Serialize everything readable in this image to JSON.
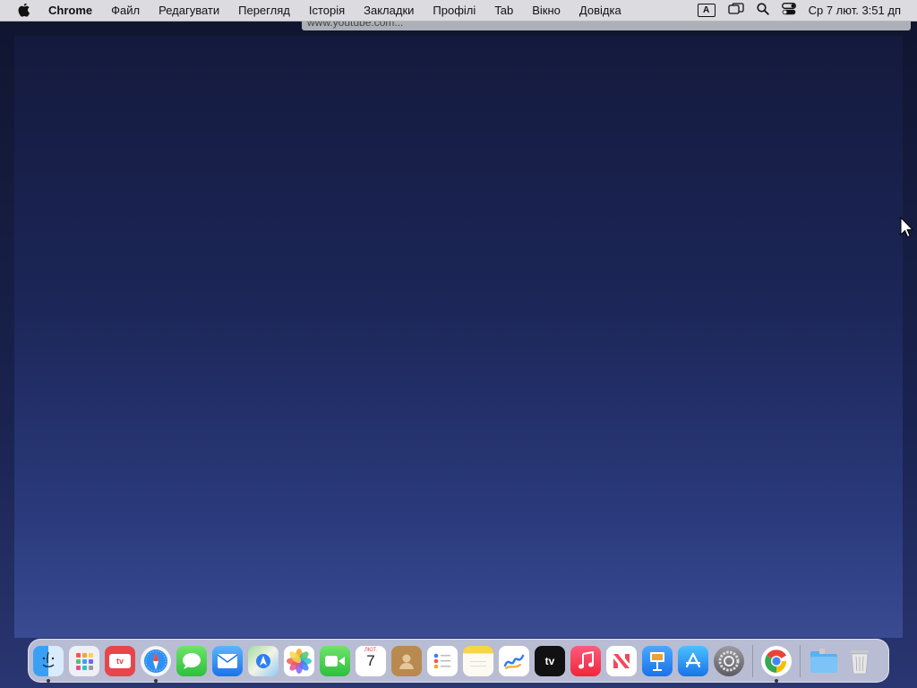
{
  "menubar": {
    "app_name": "Chrome",
    "menus": [
      "Файл",
      "Редагувати",
      "Перегляд",
      "Історія",
      "Закладки",
      "Профілі",
      "Tab",
      "Вікно",
      "Довідка"
    ],
    "input_source": "A",
    "clock": "Ср 7 лют.  3:51 дп"
  },
  "browser": {
    "url_hint": "www.youtube.com..."
  },
  "dock": {
    "calendar_month": "ЛЮТ.",
    "calendar_day": "7",
    "tv_label": "tv",
    "apps": [
      {
        "name": "Finder",
        "icon": "finder-icon",
        "running": true
      },
      {
        "name": "Launchpad",
        "icon": "launchpad-icon",
        "running": false
      },
      {
        "name": "TV Remote",
        "icon": "tv-app-red-icon",
        "running": false
      },
      {
        "name": "Safari",
        "icon": "safari-icon",
        "running": true
      },
      {
        "name": "Messages",
        "icon": "messages-icon",
        "running": false
      },
      {
        "name": "Mail",
        "icon": "mail-icon",
        "running": false
      },
      {
        "name": "Maps",
        "icon": "maps-icon",
        "running": false
      },
      {
        "name": "Photos",
        "icon": "photos-icon",
        "running": false
      },
      {
        "name": "FaceTime",
        "icon": "facetime-icon",
        "running": false
      },
      {
        "name": "Calendar",
        "icon": "calendar-icon",
        "running": false
      },
      {
        "name": "Contacts",
        "icon": "contacts-icon",
        "running": false
      },
      {
        "name": "Reminders",
        "icon": "reminders-icon",
        "running": false
      },
      {
        "name": "Notes",
        "icon": "notes-icon",
        "running": false
      },
      {
        "name": "Freeform",
        "icon": "freeform-icon",
        "running": false
      },
      {
        "name": "TV",
        "icon": "apple-tv-icon",
        "running": false
      },
      {
        "name": "Music",
        "icon": "music-icon",
        "running": false
      },
      {
        "name": "News",
        "icon": "news-icon",
        "running": false
      },
      {
        "name": "Keynote",
        "icon": "keynote-icon",
        "running": false
      },
      {
        "name": "App Store",
        "icon": "app-store-icon",
        "running": false
      },
      {
        "name": "System Settings",
        "icon": "system-settings-icon",
        "running": false
      },
      {
        "name": "Chrome",
        "icon": "chrome-icon",
        "running": true
      },
      {
        "name": "Downloads",
        "icon": "folder-icon",
        "running": false
      },
      {
        "name": "Trash",
        "icon": "trash-icon",
        "running": false
      }
    ]
  },
  "colors": {
    "desktop_top": "#141a3d",
    "desktop_bottom": "#3a4b92",
    "menubar": "#dcdce0"
  }
}
